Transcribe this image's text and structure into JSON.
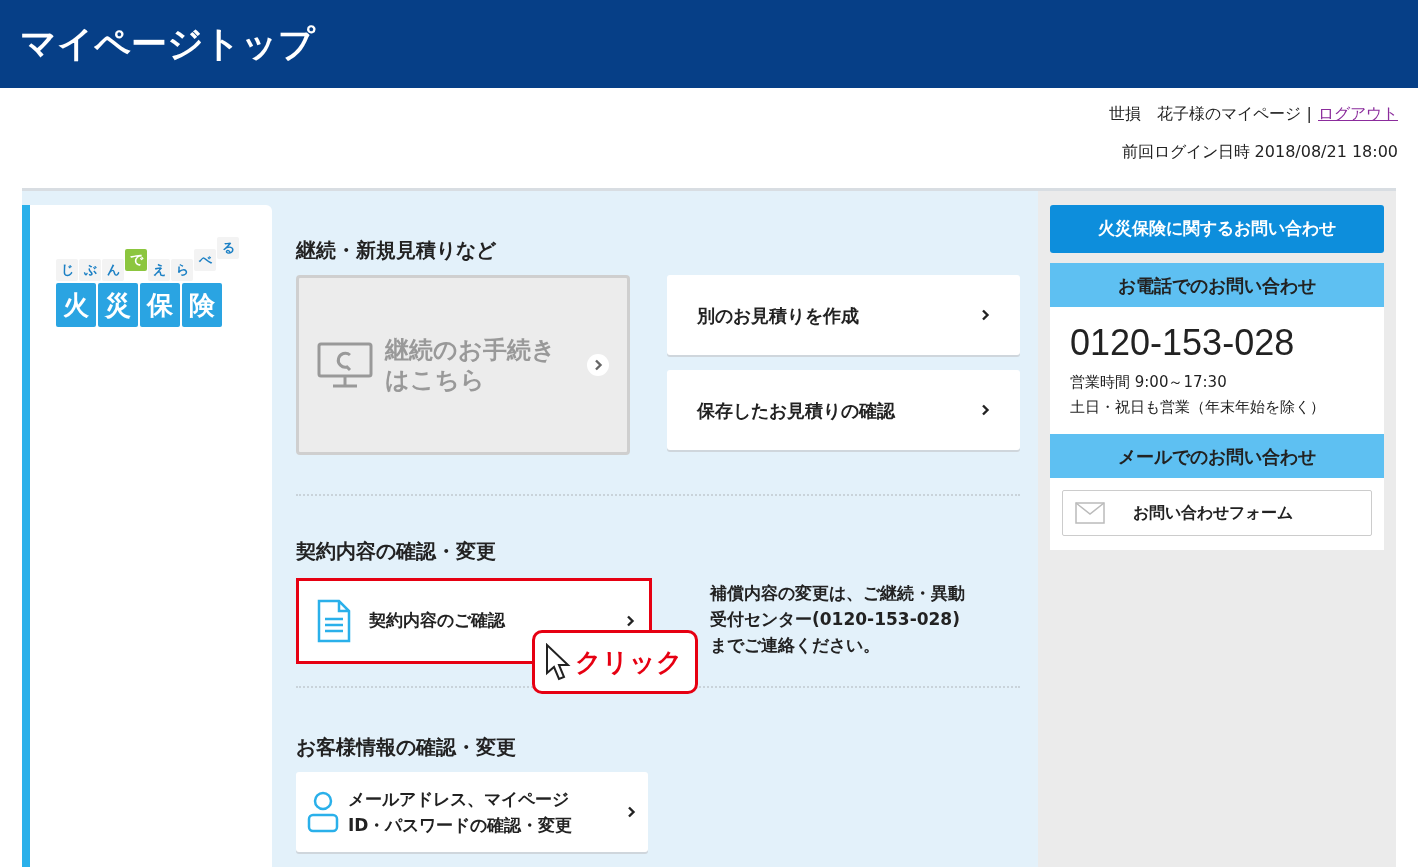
{
  "header": {
    "title": "マイページトップ"
  },
  "user_bar": {
    "greeting": "世損　花子様のマイページ",
    "separator": "|",
    "logout": "ログアウト",
    "last_login": "前回ログイン日時 2018/08/21 18:00"
  },
  "logo": {
    "tagline": "じぶんでえらべる",
    "name": "火災保険"
  },
  "sections": [
    {
      "heading": "継続・新規見積りなど",
      "renewal": {
        "label_lines": [
          "継続のお手続き",
          "はこちら"
        ],
        "disabled": true
      },
      "buttons": [
        {
          "label": "別のお見積りを作成"
        },
        {
          "label": "保存したお見積りの確認"
        }
      ]
    },
    {
      "heading": "契約内容の確認・変更",
      "contract": {
        "label": "契約内容のご確認",
        "highlighted": true
      },
      "note_lines": [
        "補償内容の変更は、ご継続・異動",
        "受付センター(0120-153-028)",
        "までご連絡ください。"
      ],
      "callout": "クリック"
    },
    {
      "heading": "お客様情報の確認・変更",
      "account": {
        "label_lines": [
          "メールアドレス、マイページ",
          "ID・パスワードの確認・変更"
        ]
      }
    }
  ],
  "contact": {
    "title": "火災保険に関するお問い合わせ",
    "phone_heading": "お電話でのお問い合わせ",
    "phone": "0120-153-028",
    "hours": "営業時間 9:00～17:30",
    "days": "土日・祝日も営業（年末年始を除く）",
    "mail_heading": "メールでのお問い合わせ",
    "form_button": "お問い合わせフォーム"
  }
}
